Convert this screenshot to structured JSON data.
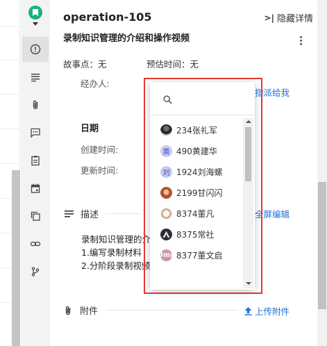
{
  "header": {
    "title": "operation-105",
    "hide_details": "隐藏详情",
    "subtitle": "录制知识管理的介绍和操作视频"
  },
  "meta": {
    "story_points": "故事点：无",
    "estimated_time": "预估时间：无",
    "assignee_label": "经办人:",
    "assign_to_me": "指派给我"
  },
  "dates": {
    "section_title": "日期",
    "created_label": "创建时间:",
    "updated_label": "更新时间:"
  },
  "description": {
    "title": "描述",
    "fullscreen_edit": "全屏编辑",
    "lines": [
      "录制知识管理的介",
      "1.编写录制材料",
      "2.分阶段录制视频"
    ]
  },
  "attachments": {
    "title": "附件",
    "upload": "上传附件"
  },
  "dropdown": {
    "search_placeholder": "",
    "users": [
      {
        "label": "234张礼军",
        "avatar": "photo"
      },
      {
        "label": "490黄建华",
        "avatar": "text",
        "avatar_text": "黄"
      },
      {
        "label": "1924刘海螺",
        "avatar": "text",
        "avatar_text": "刘"
      },
      {
        "label": "2199甘闪闪",
        "avatar": "photo"
      },
      {
        "label": "8374董凡",
        "avatar": "photo"
      },
      {
        "label": "8375常社",
        "avatar": "photo"
      },
      {
        "label": "8377董文启",
        "avatar": "photo",
        "avatar_text": "Uma"
      }
    ]
  },
  "colors": {
    "link": "#1e6fd9",
    "highlight": "#e53935",
    "logo": "#19b37a"
  },
  "rail_icons": [
    "info-icon",
    "list-icon",
    "attachment-icon",
    "comment-icon",
    "clipboard-icon",
    "calendar-icon",
    "copy-icon",
    "link-icon",
    "branch-icon"
  ]
}
